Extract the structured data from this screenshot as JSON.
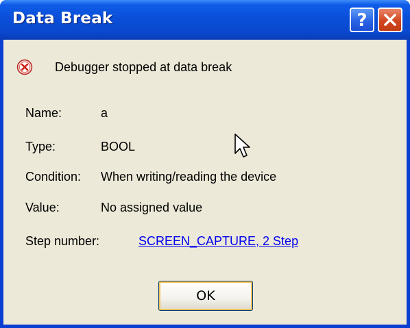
{
  "window": {
    "title": "Data Break",
    "help_symbol": "?",
    "colors": {
      "titlebar": "#0a4fd8",
      "client_bg": "#ece9d8",
      "close_button": "#d2461f",
      "link": "#0000ee"
    }
  },
  "message": {
    "icon": "error-icon",
    "text": "Debugger stopped at data break"
  },
  "fields": {
    "name": {
      "label": "Name:",
      "value": "a"
    },
    "type": {
      "label": "Type:",
      "value": "BOOL"
    },
    "condition": {
      "label": "Condition:",
      "value": "When writing/reading the device"
    },
    "value": {
      "label": "Value:",
      "value": "No assigned value"
    },
    "step": {
      "label": "Step number:",
      "value": "SCREEN_CAPTURE, 2 Step"
    }
  },
  "buttons": {
    "ok_label": "OK"
  }
}
